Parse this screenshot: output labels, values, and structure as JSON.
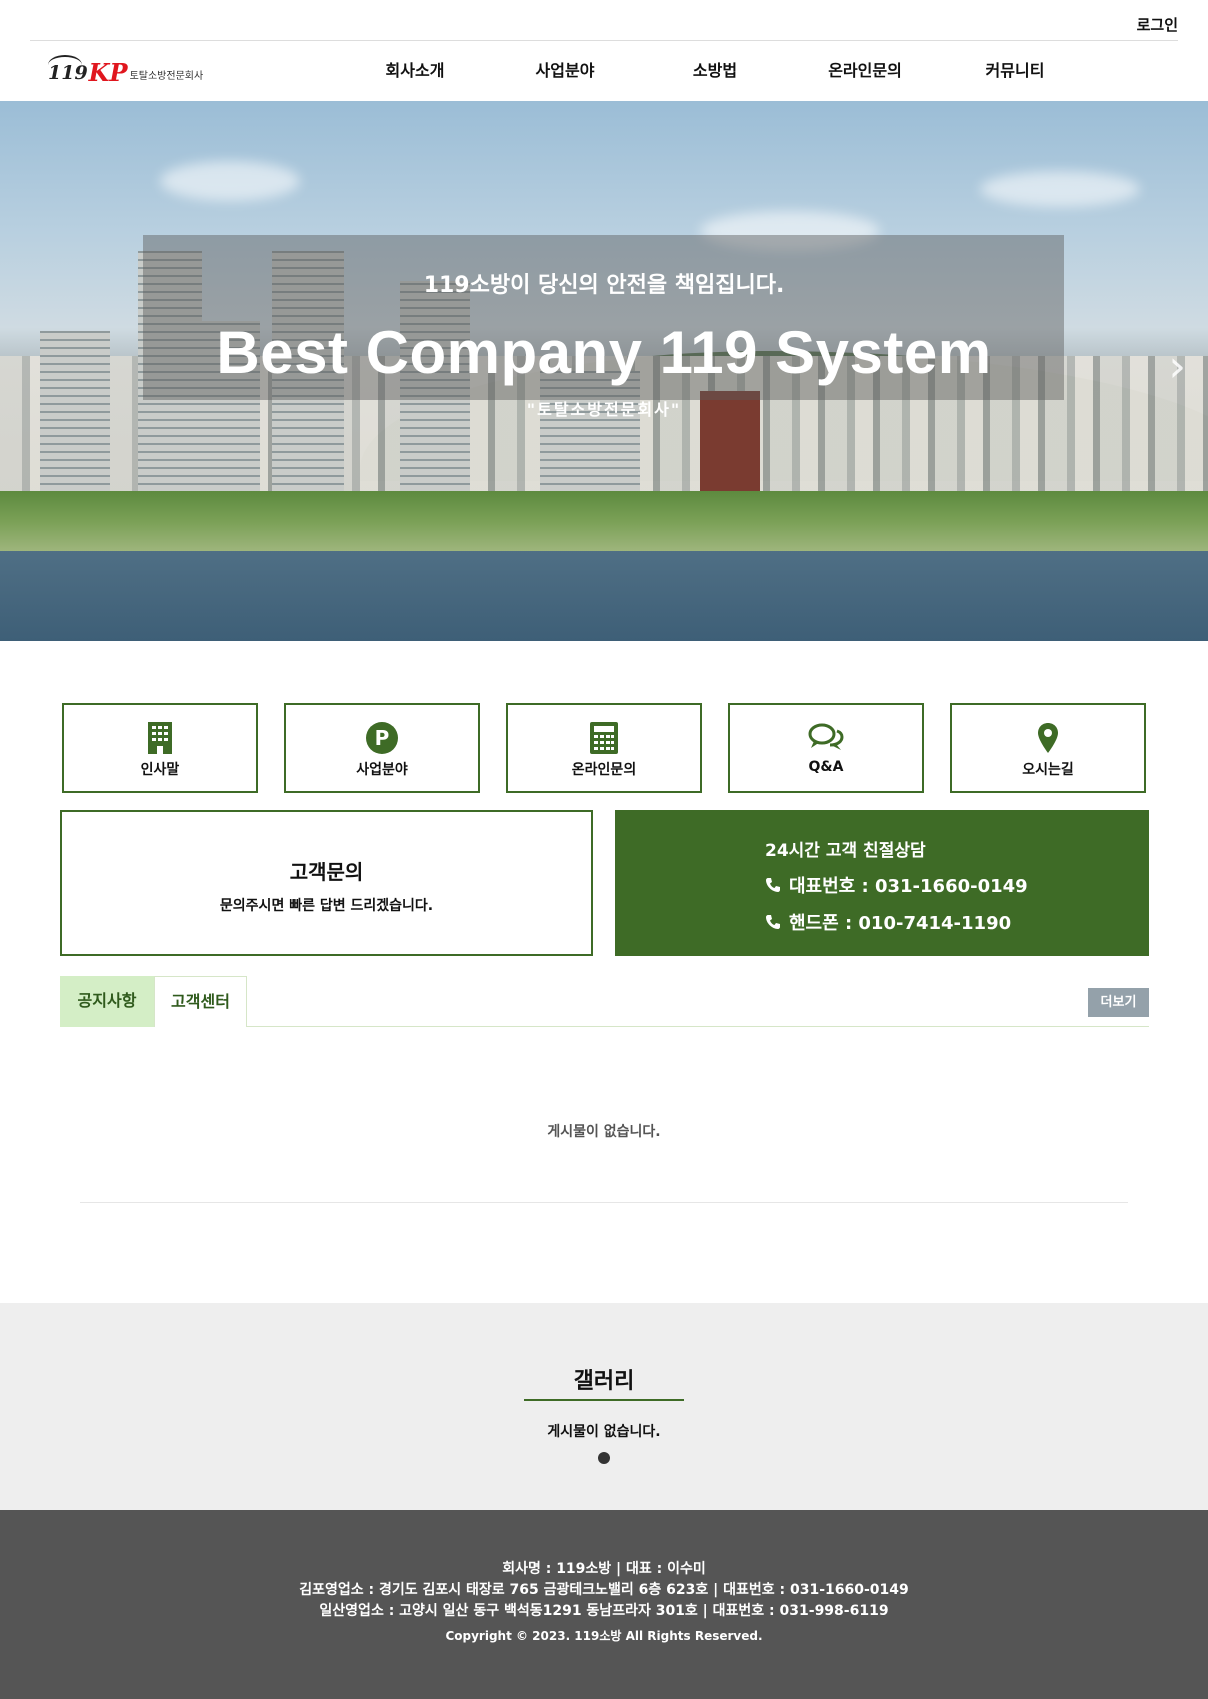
{
  "topbar": {
    "login": "로그인"
  },
  "logo": {
    "number": "119",
    "kp": "KP",
    "subtitle": "토탈소방전문회사"
  },
  "nav": {
    "items": [
      "회사소개",
      "사업분야",
      "소방법",
      "온라인문의",
      "커뮤니티"
    ]
  },
  "hero": {
    "subtitle": "119소방이 당신의 안전을 책임집니다.",
    "title": "Best Company 119 System",
    "tagline": "\"토탈소방전문회사\"",
    "next_icon": "chevron-right-icon"
  },
  "quick": {
    "items": [
      {
        "label": "인사말",
        "icon": "building-icon"
      },
      {
        "label": "사업분야",
        "icon": "parking-circle-icon"
      },
      {
        "label": "온라인문의",
        "icon": "calculator-icon"
      },
      {
        "label": "Q&A",
        "icon": "chat-bubbles-icon"
      },
      {
        "label": "오시는길",
        "icon": "map-pin-icon"
      }
    ]
  },
  "inquiry": {
    "title": "고객문의",
    "desc": "문의주시면 빠른 답변 드리겠습니다."
  },
  "call": {
    "title": "24시간 고객 친절상담",
    "main_line": "대표번호 : 031-1660-0149",
    "mobile_line": "핸드폰 : 010-7414-1190"
  },
  "board": {
    "tabs": [
      "공지사항",
      "고객센터"
    ],
    "more": "더보기",
    "empty": "게시물이 없습니다."
  },
  "gallery": {
    "title": "갤러리",
    "empty": "게시물이 없습니다."
  },
  "footer": {
    "line1": "회사명 : 119소방 | 대표 : 이수미",
    "line2": "김포영업소 : 경기도 김포시 태장로 765 금광테크노밸리 6층 623호  |  대표번호 : 031-1660-0149",
    "line3": "일산영업소 : 고양시 일산 동구 백석동1291 동남프라자 301호  |  대표번호 : 031-998-6119",
    "copyright": "Copyright © 2023. 119소방 All Rights Reserved."
  },
  "colors": {
    "brand_green": "#3e6b26",
    "tab_active_bg": "#d4eec6",
    "more_button": "#94a1aa",
    "footer_bg": "#555555",
    "logo_red": "#e0161e"
  }
}
